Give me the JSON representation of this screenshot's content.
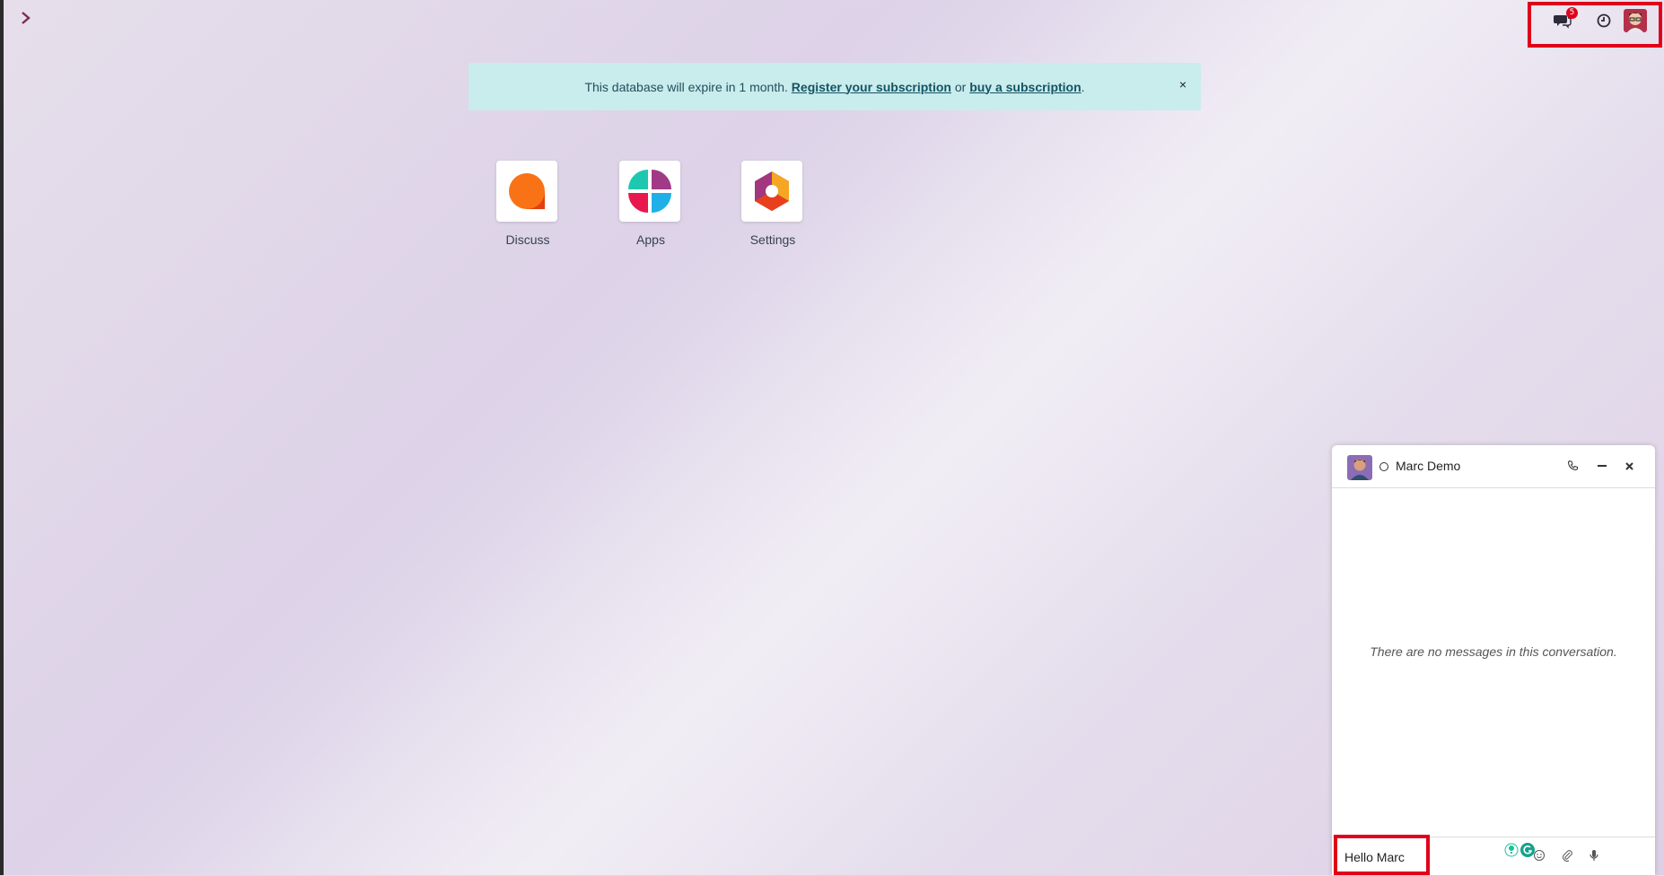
{
  "navbar": {
    "toggle_icon": "chevron-right-icon",
    "messages_badge": "5"
  },
  "banner": {
    "text_prefix": "This database will expire in 1 month.",
    "register_link": "Register your subscription",
    "or_text": "or",
    "buy_link": "buy a subscription",
    "suffix": ".",
    "close_label": "×"
  },
  "apps": [
    {
      "label": "Discuss"
    },
    {
      "label": "Apps"
    },
    {
      "label": "Settings"
    }
  ],
  "chat": {
    "name": "Marc Demo",
    "empty_text": "There are no messages in this conversation.",
    "input_value": "Hello Marc"
  },
  "colors": {
    "highlight": "#e0001a",
    "banner_bg": "#c9ecec",
    "accent": "#7b2d4f"
  }
}
